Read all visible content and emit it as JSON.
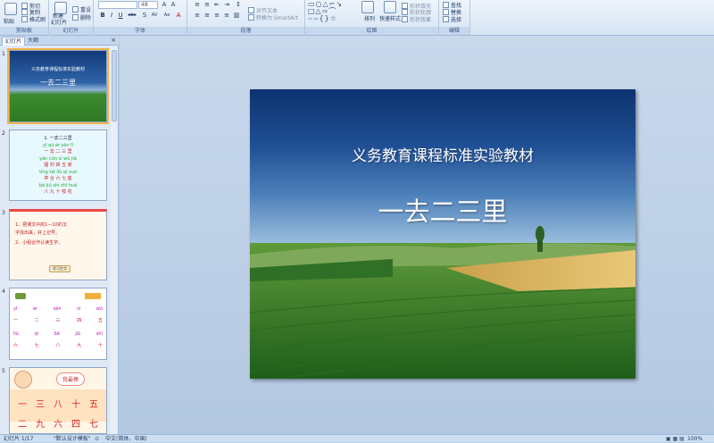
{
  "ribbon": {
    "groups": [
      "剪贴板",
      "幻灯片",
      "字体",
      "段落",
      "绘图",
      "编辑"
    ],
    "clipboard": {
      "paste": "粘贴",
      "cut": "剪切",
      "copy": "复制",
      "format_painter": "格式刷"
    },
    "slides": {
      "new_slide": "新建",
      "new_slide_2": "幻灯片",
      "reset": "重设",
      "delete": "删除"
    },
    "font": {
      "size": "48",
      "buttons": [
        "B",
        "I",
        "U",
        "abc",
        "S",
        "AV",
        "Aa",
        "A"
      ]
    },
    "paragraph": {
      "align_text": "对齐文本",
      "convert_smartart": "转换为 SmartArt"
    },
    "drawing": {
      "arrange": "排列",
      "quick_styles": "快速样式",
      "shape_fill": "形状填充",
      "shape_outline": "形状轮廓",
      "shape_effects": "形状效果"
    },
    "editing": {
      "find": "查找",
      "replace": "替换",
      "select": "选择"
    }
  },
  "left_pane": {
    "tabs": [
      "幻灯片",
      "大纲"
    ],
    "close": "×",
    "thumbnails": [
      {
        "num": "1",
        "line1": "义务教育课程标准实验教材",
        "line2": "一去二三里"
      },
      {
        "num": "2",
        "lines": [
          "1. 一去二三里",
          "yī  qù  èr  sān  lǐ",
          "一 去 二 三 里",
          "yān cūn  sì  wǔ jiā",
          "烟 村 四 五 家",
          "tíng tái liù qī zuò",
          "亭 台 六 七 座",
          "bā jiǔ shí zhī huā",
          "八 九 十 枝 花"
        ]
      },
      {
        "num": "3",
        "lines": [
          "1、把课文中的1—10的汉",
          "字找出来，并上记号。",
          "2、小组合作认读生字。"
        ],
        "button": "学习生字"
      },
      {
        "num": "4",
        "rows": [
          [
            "yī",
            "èr",
            "sān",
            "sì",
            "wǔ"
          ],
          [
            "一",
            "二",
            "三",
            "四",
            "五"
          ],
          [
            "liù",
            "qī",
            "bā",
            "jiǔ",
            "shí"
          ],
          [
            "六",
            "七",
            "八",
            "九",
            "十"
          ]
        ]
      },
      {
        "num": "5",
        "bubble": "我最棒",
        "rows": [
          [
            "一",
            "三",
            "八",
            "十",
            "五"
          ],
          [
            "二",
            "九",
            "六",
            "四",
            "七"
          ]
        ]
      }
    ]
  },
  "slide": {
    "subtitle": "义务教育课程标准实验教材",
    "title": "一去二三里"
  },
  "status": {
    "slide_info": "幻灯片 1/17",
    "theme": "\"默认设计模板\"",
    "language": "中文(简体，中国)",
    "zoom": "100%"
  }
}
